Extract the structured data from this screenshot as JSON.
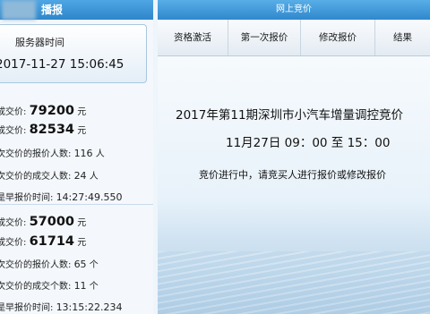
{
  "left": {
    "header_title": "播报",
    "server_label": "服务器时间",
    "server_time": "2017-11-27 15:06:45",
    "groups": [
      {
        "min_price_label": "成交价:",
        "min_price": "79200",
        "avg_price_label": "成交价:",
        "avg_price": "82534",
        "unit_yuan": "元",
        "bidders_label": "次交价的报价人数:",
        "bidders": "116",
        "bidders_unit": "人",
        "deals_label": "次交价的成交人数:",
        "deals": "24",
        "deals_unit": "人",
        "time_label": "是早报价时间:",
        "time": "14:27:49.550"
      },
      {
        "min_price_label": "成交价:",
        "min_price": "57000",
        "avg_price_label": "成交价:",
        "avg_price": "61714",
        "unit_yuan": "元",
        "bidders_label": "次交价的报价人数:",
        "bidders": "65",
        "bidders_unit": "个",
        "deals_label": "次交价的成交个数:",
        "deals": "11",
        "deals_unit": "个",
        "time_label": "是早报价时间:",
        "time": "13:15:22.234"
      }
    ]
  },
  "right": {
    "header_title": "网上竞价",
    "tabs": [
      {
        "label": "资格激活"
      },
      {
        "label": "第一次报价"
      },
      {
        "label": "修改报价"
      },
      {
        "label": "结果"
      }
    ],
    "auction_title": "2017年第11期深圳市小汽车增量调控竞价",
    "auction_period": "11月27日 09：00 至 15：00",
    "status_text": "竞价进行中，请竞买人进行报价或修改报价"
  }
}
